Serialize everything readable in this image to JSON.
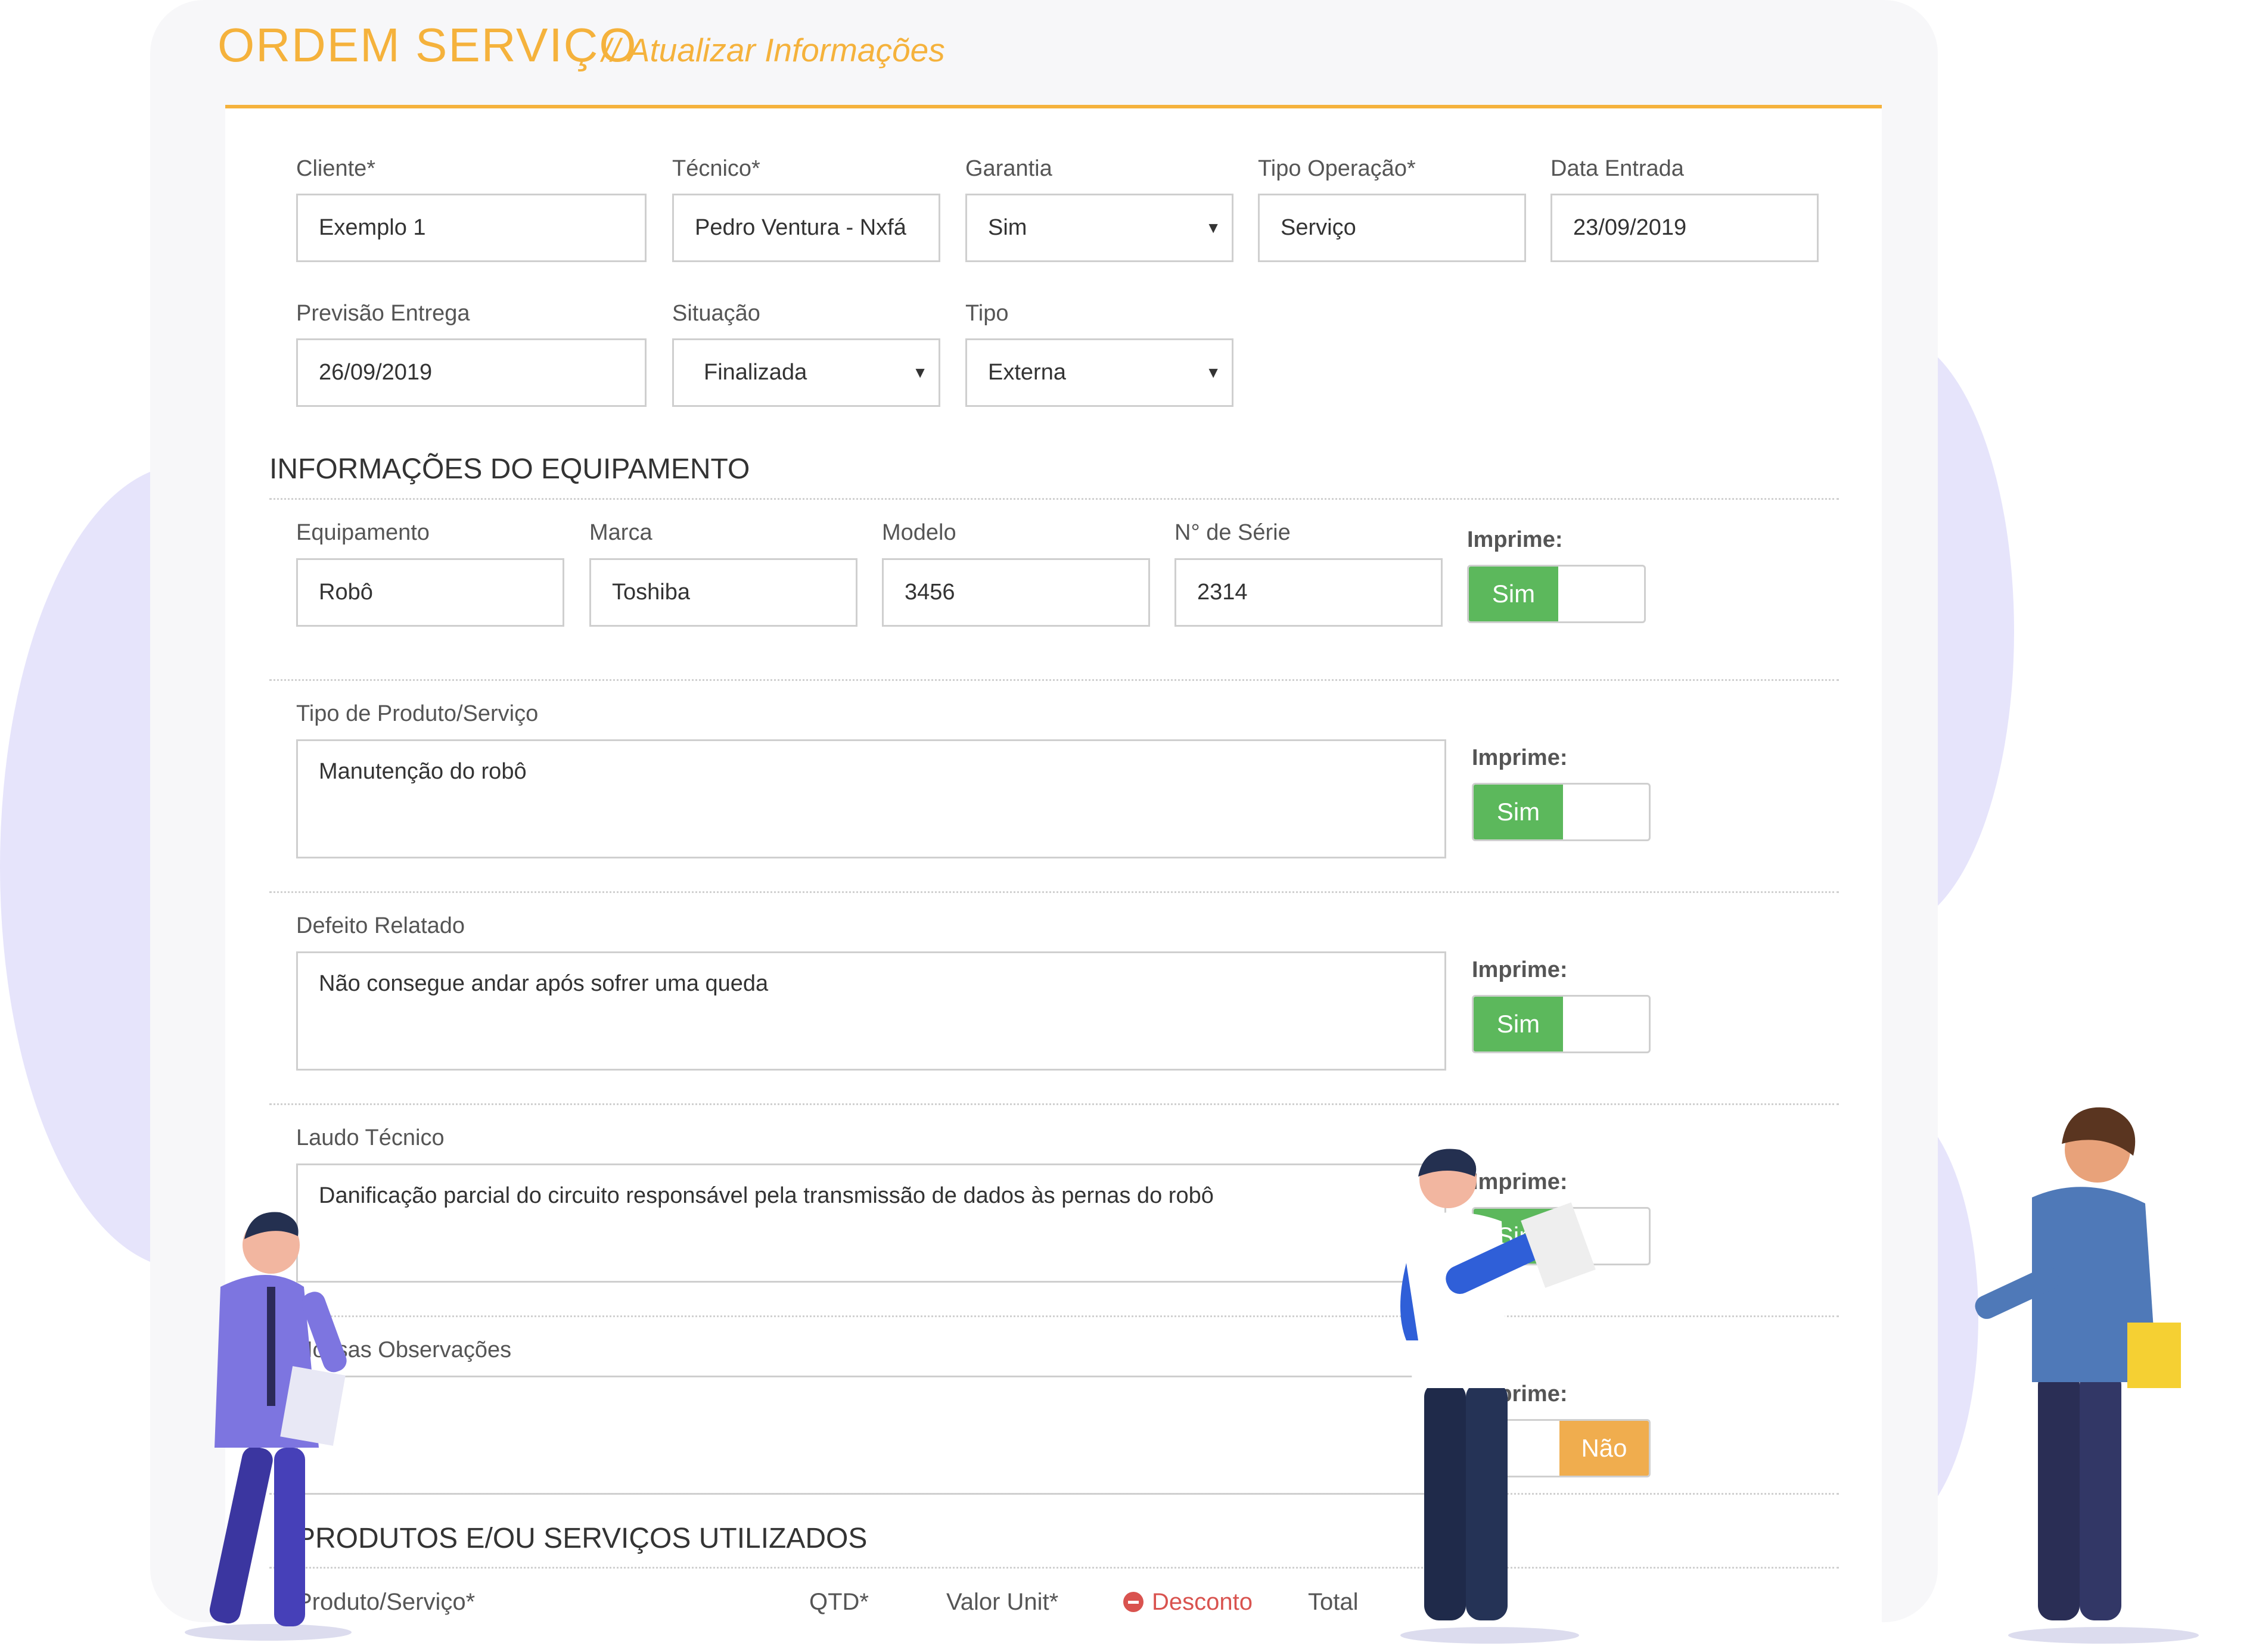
{
  "header": {
    "title": "ORDEM SERVIÇO",
    "subtitle": "// Atualizar Informações"
  },
  "general": {
    "cliente": {
      "label": "Cliente*",
      "value": "Exemplo 1"
    },
    "tecnico": {
      "label": "Técnico*",
      "value": "Pedro Ventura - Nxfá"
    },
    "garantia": {
      "label": "Garantia",
      "value": "Sim"
    },
    "tipo_operacao": {
      "label": "Tipo Operação*",
      "value": "Serviço"
    },
    "data_entrada": {
      "label": "Data Entrada",
      "value": "23/09/2019"
    },
    "previsao_entrega": {
      "label": "Previsão Entrega",
      "value": "26/09/2019"
    },
    "situacao": {
      "label": "Situação",
      "value": "Finalizada"
    },
    "tipo": {
      "label": "Tipo",
      "value": "Externa"
    }
  },
  "equipment": {
    "section_title": "INFORMAÇÕES DO EQUIPAMENTO",
    "equipamento": {
      "label": "Equipamento",
      "value": "Robô"
    },
    "marca": {
      "label": "Marca",
      "value": "Toshiba"
    },
    "modelo": {
      "label": "Modelo",
      "value": "3456"
    },
    "serie": {
      "label": "N° de Série",
      "value": "2314"
    }
  },
  "print_toggles": {
    "label": "Imprime:",
    "on_label": "Sim",
    "off_label": "Não"
  },
  "details": {
    "tipo_produto": {
      "label": "Tipo de Produto/Serviço",
      "value": "Manutenção do robô"
    },
    "defeito": {
      "label": "Defeito Relatado",
      "value": "Não consegue andar após sofrer uma queda"
    },
    "laudo": {
      "label": "Laudo Técnico",
      "value": "Danificação parcial do circuito responsável pela transmissão de dados às pernas do robô"
    },
    "observacoes": {
      "label": "Nossas Observações",
      "value": ""
    }
  },
  "products": {
    "section_title": "PRODUTOS E/OU SERVIÇOS UTILIZADOS",
    "columns": {
      "produto": "Produto/Serviço*",
      "qtd": "QTD*",
      "valor_unit": "Valor Unit*",
      "desconto": "Desconto",
      "total": "Total"
    }
  },
  "colors": {
    "accent": "#f5b23c",
    "toggle_on": "#5cb85c",
    "toggle_off": "#f0ad4e",
    "danger": "#d9534f",
    "blob": "#e6e4fb"
  }
}
